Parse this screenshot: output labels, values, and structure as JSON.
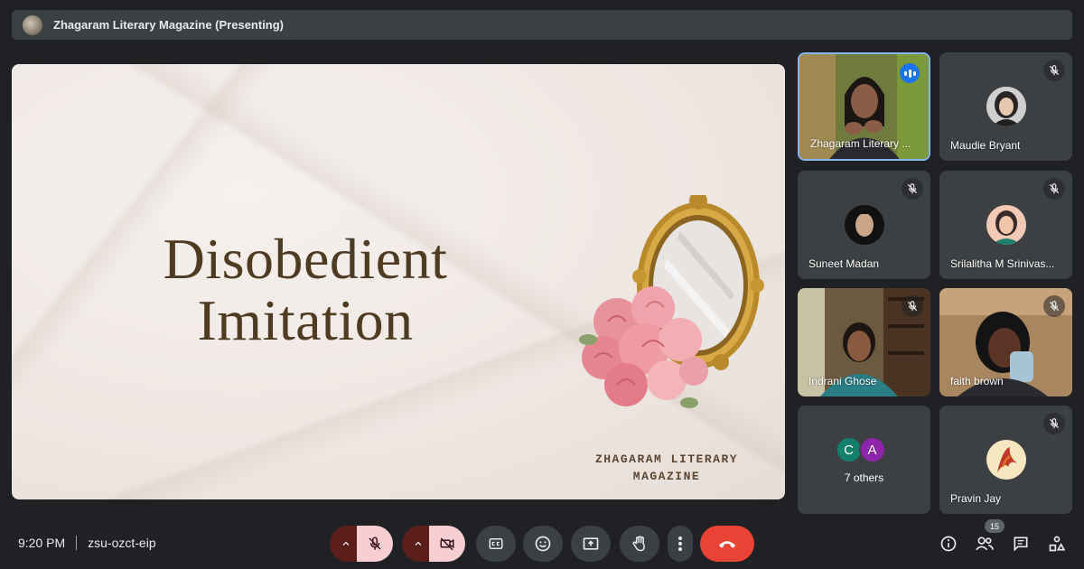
{
  "topbar": {
    "title": "Zhagaram Literary Magazine (Presenting)"
  },
  "slide": {
    "title_line1": "Disobedient",
    "title_line2": "Imitation",
    "brand_line1": "ZHAGARAM LITERARY",
    "brand_line2": "MAGAZINE"
  },
  "participants": [
    {
      "name": "Zhagaram Literary ...",
      "status": "speaking"
    },
    {
      "name": "Maudie Bryant",
      "status": "muted"
    },
    {
      "name": "Suneet Madan",
      "status": "muted"
    },
    {
      "name": "Srilalitha M Srinivas...",
      "status": "muted"
    },
    {
      "name": "Indrani Ghose",
      "status": "muted"
    },
    {
      "name": "faith brown",
      "status": "muted"
    },
    {
      "name": "Pravin Jay",
      "status": "muted"
    }
  ],
  "others": {
    "initials": [
      "C",
      "A"
    ],
    "colors": [
      "#12806b",
      "#8e24aa"
    ],
    "label": "7 others"
  },
  "bottombar": {
    "time": "9:20 PM",
    "meeting_code": "zsu-ozct-eip",
    "participant_count": "15"
  },
  "colors": {
    "background": "#202124",
    "tile": "#3c4043",
    "active_speaker": "#8ab4f8",
    "hangup": "#ea4335",
    "muted_control": "#f6cdd0",
    "slide_text": "#4e3b22"
  },
  "icons": {
    "mic_off": "mic-off-icon",
    "camera_off": "camera-off-icon",
    "captions": "closed-captions-icon",
    "emoji": "emoji-icon",
    "present": "present-screen-icon",
    "raise_hand": "raise-hand-icon",
    "more": "more-vert-icon",
    "hangup": "call-end-icon",
    "info": "info-icon",
    "people": "people-icon",
    "chat": "chat-icon",
    "activities": "activities-icon"
  }
}
